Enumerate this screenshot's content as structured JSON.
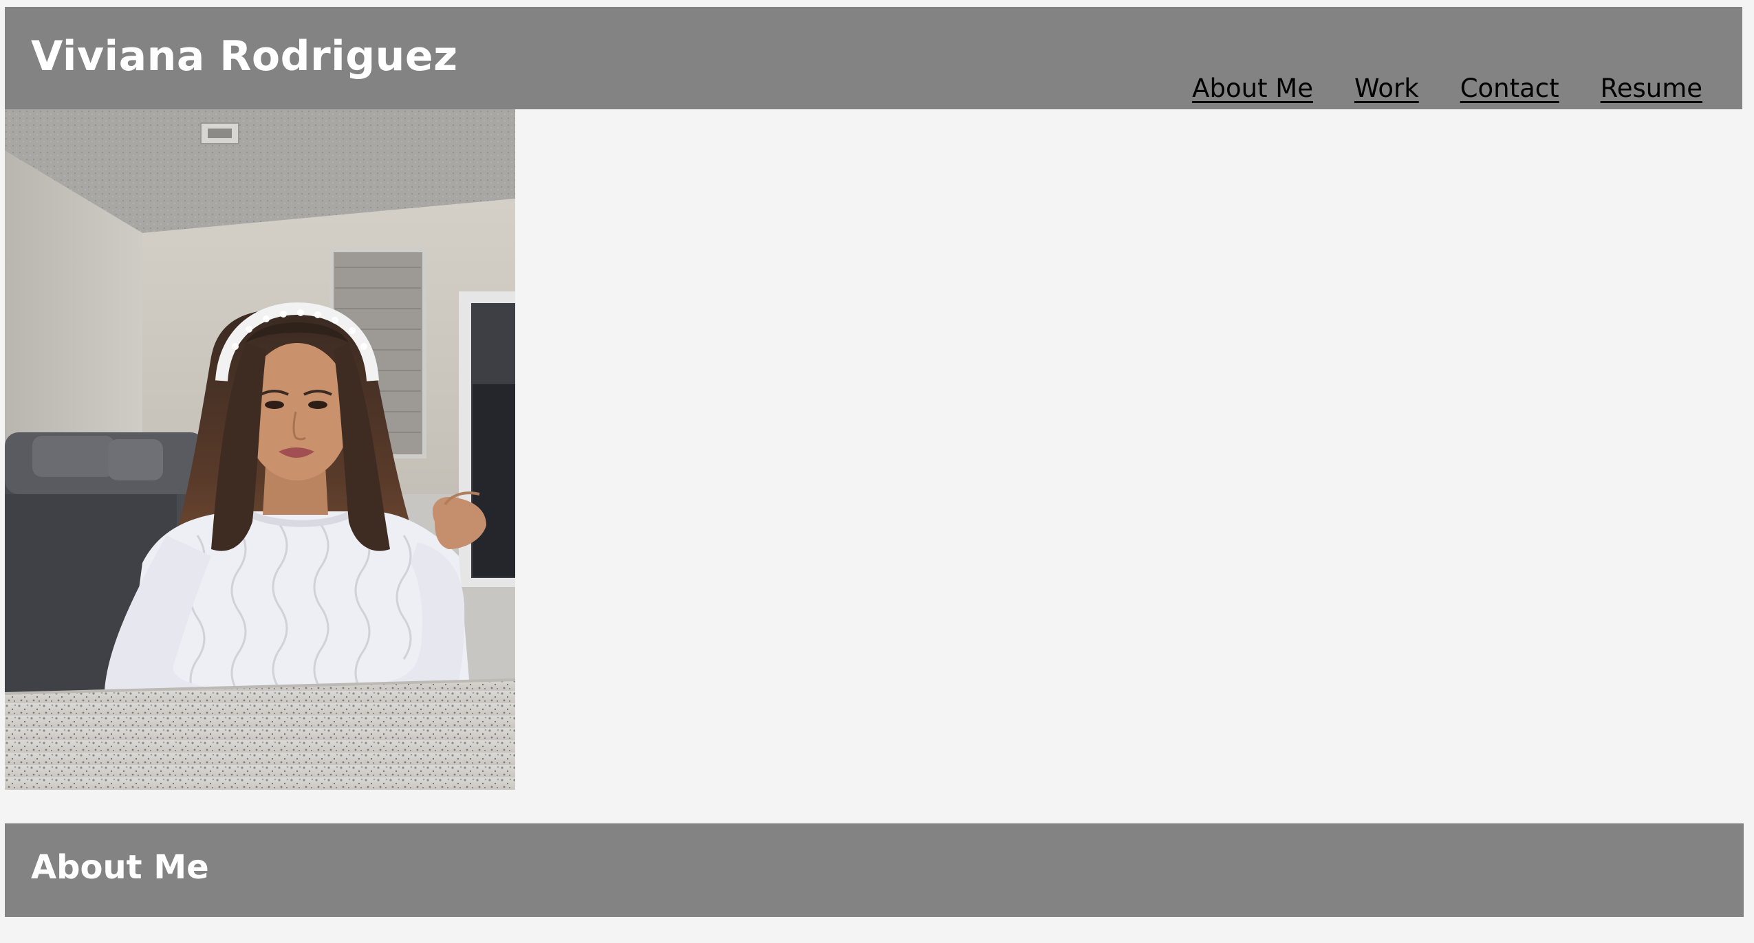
{
  "header": {
    "title": "Viviana Rodriguez",
    "background_color": "#838383",
    "title_color": "#ffffff"
  },
  "nav": {
    "items": [
      {
        "label": "About Me"
      },
      {
        "label": "Work"
      },
      {
        "label": "Contact"
      },
      {
        "label": "Resume"
      }
    ]
  },
  "hero": {
    "image_description": "portrait-photo"
  },
  "about": {
    "title": "About Me"
  },
  "colors": {
    "page_background": "#f4f4f4",
    "bar_background": "#838383",
    "link_color": "#000000"
  }
}
